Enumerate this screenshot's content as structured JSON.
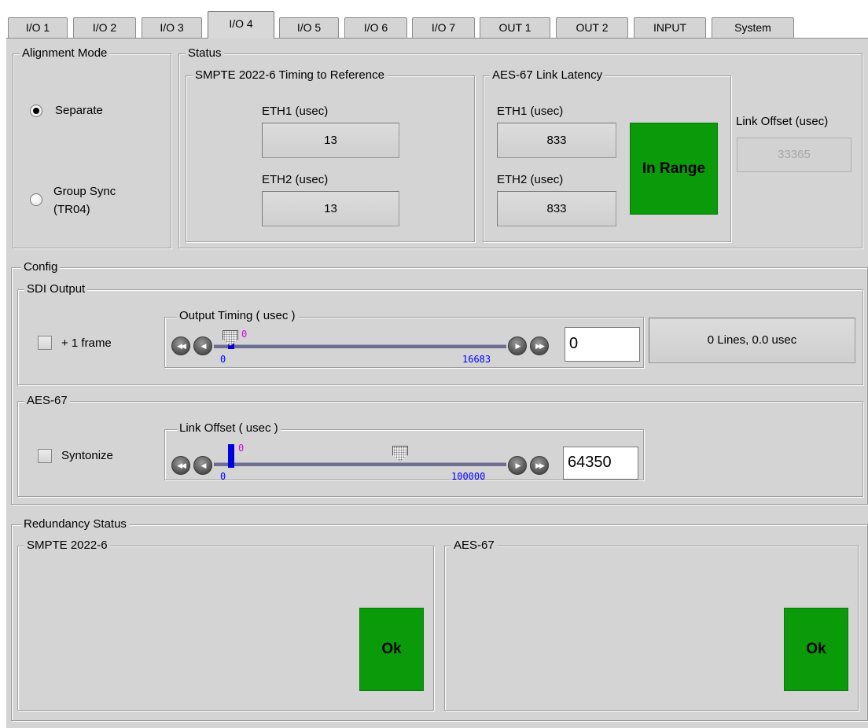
{
  "tabs": [
    "I/O 1",
    "I/O 2",
    "I/O 3",
    "I/O 4",
    "I/O 5",
    "I/O 6",
    "I/O 7",
    "OUT 1",
    "OUT 2",
    "INPUT",
    "System"
  ],
  "active_tab": "I/O 4",
  "alignment": {
    "title": "Alignment Mode",
    "options": [
      "Separate",
      "Group Sync",
      "(TR04)"
    ],
    "selected": "Separate"
  },
  "status": {
    "title": "Status",
    "smpte": {
      "title": "SMPTE 2022-6 Timing to Reference",
      "eth1_label": "ETH1 (usec)",
      "eth1_value": "13",
      "eth2_label": "ETH2 (usec)",
      "eth2_value": "13"
    },
    "aes": {
      "title": "AES-67 Link Latency",
      "eth1_label": "ETH1 (usec)",
      "eth1_value": "833",
      "eth2_label": "ETH2 (usec)",
      "eth2_value": "833",
      "state": "In Range"
    },
    "link_offset_label": "Link Offset (usec)",
    "link_offset_value": "33365"
  },
  "config": {
    "title": "Config",
    "sdi": {
      "title": "SDI Output",
      "checkbox_label": "+ 1 frame",
      "slider_title": "Output Timing ( usec )",
      "min": "0",
      "max": "16683",
      "marker": "0",
      "value": "0",
      "readout": "0 Lines, 0.0 usec"
    },
    "aes": {
      "title": "AES-67",
      "checkbox_label": "Syntonize",
      "slider_title": "Link Offset ( usec )",
      "min": "0",
      "max": "100000",
      "marker": "0",
      "value": "64350"
    }
  },
  "redundancy": {
    "title": "Redundancy Status",
    "smpte_title": "SMPTE 2022-6",
    "smpte_state": "Ok",
    "aes_title": "AES-67",
    "aes_state": "Ok"
  },
  "colors": {
    "panel": "#d4d4d4",
    "ok_green": "#0a9a0a",
    "tick_blue": "#0000ff",
    "tick_magenta": "#e000e0"
  }
}
